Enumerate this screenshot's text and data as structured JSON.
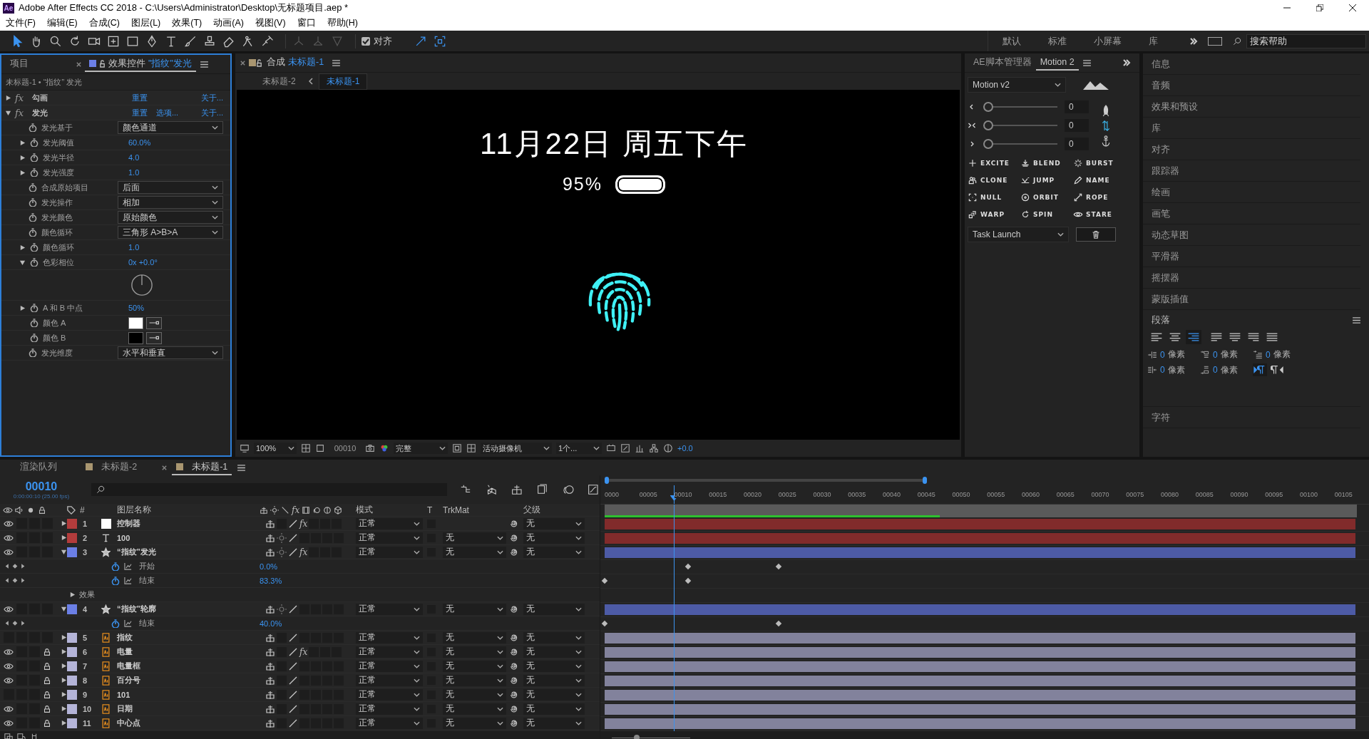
{
  "window": {
    "logo": "Ae",
    "title": "Adobe After Effects CC 2018 - C:\\Users\\Administrator\\Desktop\\无标题项目.aep *"
  },
  "menu": [
    "文件(F)",
    "编辑(E)",
    "合成(C)",
    "图层(L)",
    "效果(T)",
    "动画(A)",
    "视图(V)",
    "窗口",
    "帮助(H)"
  ],
  "toolbar": {
    "snap": {
      "label": "对齐",
      "checked": true
    }
  },
  "workspaces": [
    "默认",
    "标准",
    "小屏幕",
    "库"
  ],
  "help_search": {
    "placeholder": "搜索帮助"
  },
  "effect_controls": {
    "tabs": [
      {
        "label": "项目",
        "selected": false
      },
      {
        "label": "效果控件",
        "target": "\"指纹\"发光",
        "selected": true
      }
    ],
    "breadcrumb": "未标题-1 • “指纹” 发光",
    "effects": [
      {
        "badge": "fx",
        "name": "勾画",
        "expanded": false,
        "reset": "重置",
        "about": "关于..."
      },
      {
        "badge": "fx",
        "name": "发光",
        "expanded": true,
        "reset": "重置",
        "options": "选项...",
        "about": "关于..."
      }
    ],
    "properties": [
      {
        "kind": "dropdown",
        "name": "发光基于",
        "value": "颜色通道"
      },
      {
        "kind": "number",
        "name": "发光阈值",
        "value": "60.0%",
        "expanded": false
      },
      {
        "kind": "number",
        "name": "发光半径",
        "value": "4.0",
        "expanded": false
      },
      {
        "kind": "number",
        "name": "发光强度",
        "value": "1.0",
        "expanded": false
      },
      {
        "kind": "dropdown",
        "name": "合成原始项目",
        "value": "后面"
      },
      {
        "kind": "dropdown",
        "name": "发光操作",
        "value": "相加"
      },
      {
        "kind": "dropdown",
        "name": "发光颜色",
        "value": "原始颜色"
      },
      {
        "kind": "dropdown",
        "name": "颜色循环",
        "value": "三角形 A>B>A"
      },
      {
        "kind": "number",
        "name": "颜色循环",
        "value": "1.0",
        "expanded": false
      },
      {
        "kind": "angle",
        "name": "色彩相位",
        "value": "0x +0.0°",
        "expanded": true
      },
      {
        "kind": "number",
        "name": "A 和 B 中点",
        "value": "50%",
        "expanded": false
      },
      {
        "kind": "color",
        "name": "颜色 A",
        "color": "#ffffff"
      },
      {
        "kind": "color",
        "name": "颜色 B",
        "color": "#000000"
      },
      {
        "kind": "dropdown",
        "name": "发光维度",
        "value": "水平和垂直"
      }
    ]
  },
  "composition": {
    "tab": {
      "label": "合成",
      "name": "未标题-1"
    },
    "breadcrumb": [
      {
        "label": "未标题-2",
        "selected": false
      },
      {
        "label": "未标题-1",
        "selected": true
      }
    ],
    "canvas": {
      "date": "11月22日 周五下午",
      "battery_percent": "95%"
    },
    "viewer_bar": {
      "zoom": "100%",
      "timecode": "00010",
      "resolution": "完整",
      "camera": "活动摄像机",
      "views": "1个...",
      "exposure": "+0.0"
    }
  },
  "motion": {
    "tabs": [
      {
        "label": "AE脚本管理器",
        "selected": false
      },
      {
        "label": "Motion 2",
        "selected": true
      }
    ],
    "preset": "Motion v2",
    "sliders": [
      {
        "kind": "ease-in",
        "level": 0,
        "value": "0"
      },
      {
        "kind": "ease-both",
        "level": 0,
        "value": "0"
      },
      {
        "kind": "ease-out",
        "level": 0,
        "value": "0"
      }
    ],
    "buttons": [
      {
        "kind": "excite",
        "label": "EXCITE"
      },
      {
        "kind": "blend",
        "label": "BLEND"
      },
      {
        "kind": "burst",
        "label": "BURST"
      },
      {
        "kind": "clone",
        "label": "CLONE"
      },
      {
        "kind": "jump",
        "label": "JUMP"
      },
      {
        "kind": "name",
        "label": "NAME"
      },
      {
        "kind": "null",
        "label": "NULL"
      },
      {
        "kind": "orbit",
        "label": "ORBIT"
      },
      {
        "kind": "rope",
        "label": "ROPE"
      },
      {
        "kind": "warp",
        "label": "WARP"
      },
      {
        "kind": "spin",
        "label": "SPIN"
      },
      {
        "kind": "stare",
        "label": "STARE"
      }
    ],
    "task": "Task Launch"
  },
  "panels": [
    "信息",
    "音频",
    "效果和预设",
    "库",
    "对齐",
    "跟踪器",
    "绘画",
    "画笔",
    "动态草图",
    "平滑器",
    "摇摆器",
    "蒙版插值"
  ],
  "paragraph": {
    "title": "段落",
    "align": [
      {
        "kind": "left",
        "selected": false
      },
      {
        "kind": "center",
        "selected": false
      },
      {
        "kind": "right",
        "selected": true
      },
      {
        "kind": "justify-left",
        "selected": false
      },
      {
        "kind": "justify-center",
        "selected": false
      },
      {
        "kind": "justify-right",
        "selected": false
      },
      {
        "kind": "justify-all",
        "selected": false
      }
    ],
    "indents": [
      {
        "kind": "left-indent",
        "value": "0",
        "unit": "像素"
      },
      {
        "kind": "space-before",
        "value": "0",
        "unit": "像素"
      },
      {
        "kind": "first-line",
        "value": "0",
        "unit": "像素"
      },
      {
        "kind": "right-indent",
        "value": "0",
        "unit": "像素"
      },
      {
        "kind": "space-after",
        "value": "0",
        "unit": "像素"
      }
    ],
    "direction": [
      {
        "kind": "ltr",
        "selected": true
      },
      {
        "kind": "rtl",
        "selected": false
      }
    ]
  },
  "panels_after": [
    "字符"
  ],
  "timeline": {
    "tabs": [
      {
        "kind": "queue",
        "label": "渲染队列",
        "selected": false
      },
      {
        "kind": "comp",
        "label": "未标题-2",
        "selected": false
      },
      {
        "kind": "comp",
        "label": "未标题-1",
        "selected": true
      }
    ],
    "timecode": "00010",
    "timecode_detail": "0:00:00:10 (25.00 fps)",
    "columns": {
      "index": "#",
      "name": "图层名称",
      "effects": "fx",
      "mode": "模式",
      "t": "T",
      "trkmat": "TrkMat",
      "parent": "父级"
    },
    "ruler": [
      "0000",
      "00005",
      "00010",
      "00015",
      "00020",
      "00025",
      "00030",
      "00035",
      "00040",
      "00045",
      "00050",
      "00055",
      "00060",
      "00065",
      "00070",
      "00075",
      "00080",
      "00085",
      "00090",
      "00095",
      "00100",
      "00105"
    ],
    "zoom_slider": {
      "level": 0.3
    },
    "layers": [
      {
        "index": "1",
        "fx": true,
        "kind": "solid",
        "name": "控制器",
        "color": "#b33c3c",
        "visible": true,
        "locked": false,
        "expanded": false,
        "effects": "fx",
        "mode": "正常",
        "parent": "无"
      },
      {
        "index": "2",
        "fx": false,
        "kind": "text",
        "name": "100",
        "color": "#b33c3c",
        "visible": true,
        "locked": false,
        "expanded": false,
        "mode": "正常",
        "trkmat": "无",
        "parent": "无"
      },
      {
        "index": "3",
        "fx": true,
        "kind": "shape",
        "name": "“指纹”发光",
        "color": "#6b7fe6",
        "visible": true,
        "locked": false,
        "expanded": true,
        "effects": "fx",
        "mode": "正常",
        "trkmat": "无",
        "parent": "无",
        "children": [
          {
            "kind": "property",
            "name": "开始",
            "value": "0.0%",
            "keyframes": [
              {
                "level": 0.112
              },
              {
                "level": 0.234
              }
            ]
          },
          {
            "kind": "property",
            "name": "结束",
            "value": "83.3%",
            "keyframes": [
              {
                "level": 0
              },
              {
                "level": 0.112
              }
            ]
          },
          {
            "kind": "group",
            "name": "效果",
            "expanded": false
          }
        ]
      },
      {
        "index": "4",
        "fx": false,
        "kind": "shape",
        "name": "“指纹”轮廓",
        "color": "#6b7fe6",
        "visible": true,
        "locked": false,
        "expanded": true,
        "mode": "正常",
        "trkmat": "无",
        "parent": "无",
        "children": [
          {
            "kind": "property",
            "name": "结束",
            "value": "40.0%",
            "keyframes": [
              {
                "level": 0
              },
              {
                "level": 0.234
              }
            ]
          }
        ]
      },
      {
        "index": "5",
        "fx": false,
        "kind": "ai",
        "name": "指纹",
        "color": "#b4b4d8",
        "visible": false,
        "locked": false,
        "expanded": false,
        "mode": "正常",
        "trkmat": "无",
        "parent": "无"
      },
      {
        "index": "6",
        "fx": true,
        "kind": "ai",
        "name": "电量",
        "color": "#b4b4d8",
        "visible": true,
        "locked": true,
        "expanded": false,
        "effects": "fx",
        "mode": "正常",
        "trkmat": "无",
        "parent": "无"
      },
      {
        "index": "7",
        "fx": false,
        "kind": "ai",
        "name": "电量框",
        "color": "#b4b4d8",
        "visible": true,
        "locked": true,
        "expanded": false,
        "mode": "正常",
        "trkmat": "无",
        "parent": "无"
      },
      {
        "index": "8",
        "fx": false,
        "kind": "ai",
        "name": "百分号",
        "color": "#b4b4d8",
        "visible": true,
        "locked": true,
        "expanded": false,
        "mode": "正常",
        "trkmat": "无",
        "parent": "无"
      },
      {
        "index": "9",
        "fx": false,
        "kind": "ai",
        "name": "101",
        "color": "#b4b4d8",
        "visible": false,
        "locked": true,
        "expanded": false,
        "mode": "正常",
        "trkmat": "无",
        "parent": "无"
      },
      {
        "index": "10",
        "fx": false,
        "kind": "ai",
        "name": "日期",
        "color": "#b4b4d8",
        "visible": true,
        "locked": true,
        "expanded": false,
        "mode": "正常",
        "trkmat": "无",
        "parent": "无"
      },
      {
        "index": "11",
        "fx": false,
        "kind": "ai",
        "name": "中心点",
        "color": "#b4b4d8",
        "visible": true,
        "locked": true,
        "expanded": false,
        "mode": "正常",
        "trkmat": "无",
        "parent": "无"
      }
    ]
  }
}
